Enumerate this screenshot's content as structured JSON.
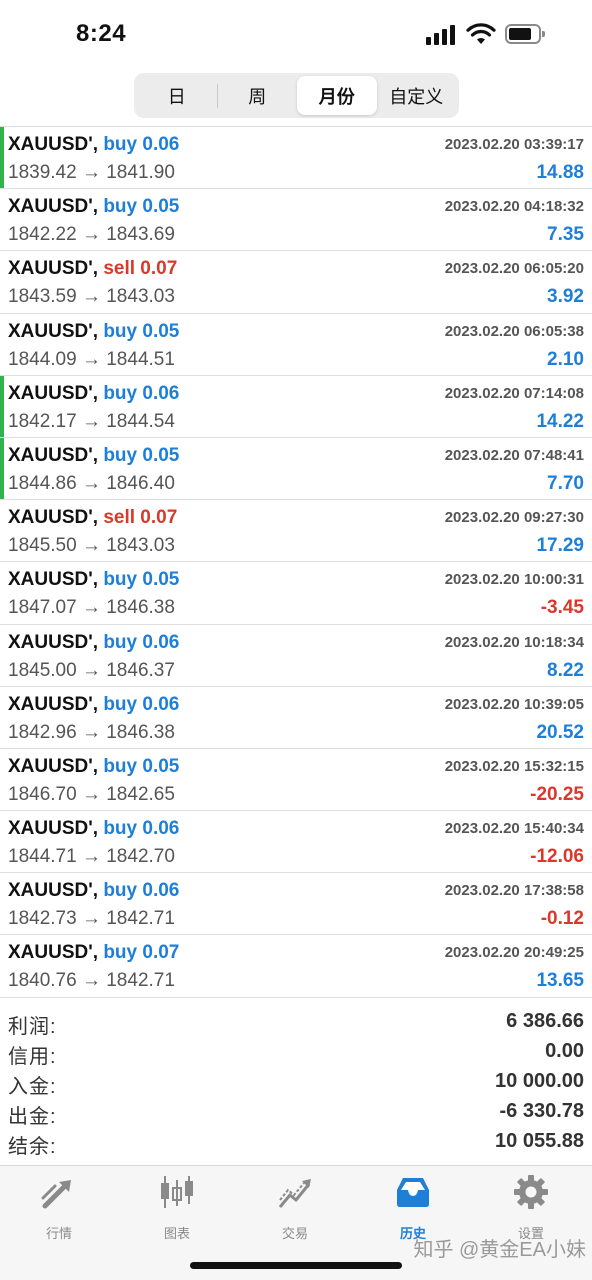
{
  "status": {
    "time": "8:24"
  },
  "tabs": [
    "日",
    "周",
    "月份",
    "自定义"
  ],
  "active_tab": 2,
  "colors": {
    "buy": "#1e7fd9",
    "sell": "#d9382b",
    "positive": "#1e7fd9",
    "negative": "#d9382b",
    "marker": "#2fb34a"
  },
  "trades": [
    {
      "symbol": "XAUUSD',",
      "side": "buy",
      "lots": "0.06",
      "time": "2023.02.20 03:39:17",
      "prices": "1839.42 → 1841.90",
      "profit": "14.88",
      "positive": true,
      "marker": true
    },
    {
      "symbol": "XAUUSD',",
      "side": "buy",
      "lots": "0.05",
      "time": "2023.02.20 04:18:32",
      "prices": "1842.22 → 1843.69",
      "profit": "7.35",
      "positive": true,
      "marker": false
    },
    {
      "symbol": "XAUUSD',",
      "side": "sell",
      "lots": "0.07",
      "time": "2023.02.20 06:05:20",
      "prices": "1843.59 → 1843.03",
      "profit": "3.92",
      "positive": true,
      "marker": false
    },
    {
      "symbol": "XAUUSD',",
      "side": "buy",
      "lots": "0.05",
      "time": "2023.02.20 06:05:38",
      "prices": "1844.09 → 1844.51",
      "profit": "2.10",
      "positive": true,
      "marker": false
    },
    {
      "symbol": "XAUUSD',",
      "side": "buy",
      "lots": "0.06",
      "time": "2023.02.20 07:14:08",
      "prices": "1842.17 → 1844.54",
      "profit": "14.22",
      "positive": true,
      "marker": true
    },
    {
      "symbol": "XAUUSD',",
      "side": "buy",
      "lots": "0.05",
      "time": "2023.02.20 07:48:41",
      "prices": "1844.86 → 1846.40",
      "profit": "7.70",
      "positive": true,
      "marker": true
    },
    {
      "symbol": "XAUUSD',",
      "side": "sell",
      "lots": "0.07",
      "time": "2023.02.20 09:27:30",
      "prices": "1845.50 → 1843.03",
      "profit": "17.29",
      "positive": true,
      "marker": false
    },
    {
      "symbol": "XAUUSD',",
      "side": "buy",
      "lots": "0.05",
      "time": "2023.02.20 10:00:31",
      "prices": "1847.07 → 1846.38",
      "profit": "-3.45",
      "positive": false,
      "marker": false
    },
    {
      "symbol": "XAUUSD',",
      "side": "buy",
      "lots": "0.06",
      "time": "2023.02.20 10:18:34",
      "prices": "1845.00 → 1846.37",
      "profit": "8.22",
      "positive": true,
      "marker": false
    },
    {
      "symbol": "XAUUSD',",
      "side": "buy",
      "lots": "0.06",
      "time": "2023.02.20 10:39:05",
      "prices": "1842.96 → 1846.38",
      "profit": "20.52",
      "positive": true,
      "marker": false
    },
    {
      "symbol": "XAUUSD',",
      "side": "buy",
      "lots": "0.05",
      "time": "2023.02.20 15:32:15",
      "prices": "1846.70 → 1842.65",
      "profit": "-20.25",
      "positive": false,
      "marker": false
    },
    {
      "symbol": "XAUUSD',",
      "side": "buy",
      "lots": "0.06",
      "time": "2023.02.20 15:40:34",
      "prices": "1844.71 → 1842.70",
      "profit": "-12.06",
      "positive": false,
      "marker": false
    },
    {
      "symbol": "XAUUSD',",
      "side": "buy",
      "lots": "0.06",
      "time": "2023.02.20 17:38:58",
      "prices": "1842.73 → 1842.71",
      "profit": "-0.12",
      "positive": false,
      "marker": false
    },
    {
      "symbol": "XAUUSD',",
      "side": "buy",
      "lots": "0.07",
      "time": "2023.02.20 20:49:25",
      "prices": "1840.76 → 1842.71",
      "profit": "13.65",
      "positive": true,
      "marker": false
    }
  ],
  "summary": [
    {
      "label": "利润:",
      "value": "6 386.66"
    },
    {
      "label": "信用:",
      "value": "0.00"
    },
    {
      "label": "入金:",
      "value": "10 000.00"
    },
    {
      "label": "出金:",
      "value": "-6 330.78"
    },
    {
      "label": "结余:",
      "value": "10 055.88"
    }
  ],
  "tabbar": [
    {
      "label": "行情",
      "icon": "quotes-arrows-icon"
    },
    {
      "label": "图表",
      "icon": "candlestick-chart-icon"
    },
    {
      "label": "交易",
      "icon": "trade-line-icon"
    },
    {
      "label": "历史",
      "icon": "inbox-history-icon"
    },
    {
      "label": "设置",
      "icon": "gear-icon"
    }
  ],
  "active_tabbar": 3,
  "watermark": "知乎 @黄金EA小妹"
}
